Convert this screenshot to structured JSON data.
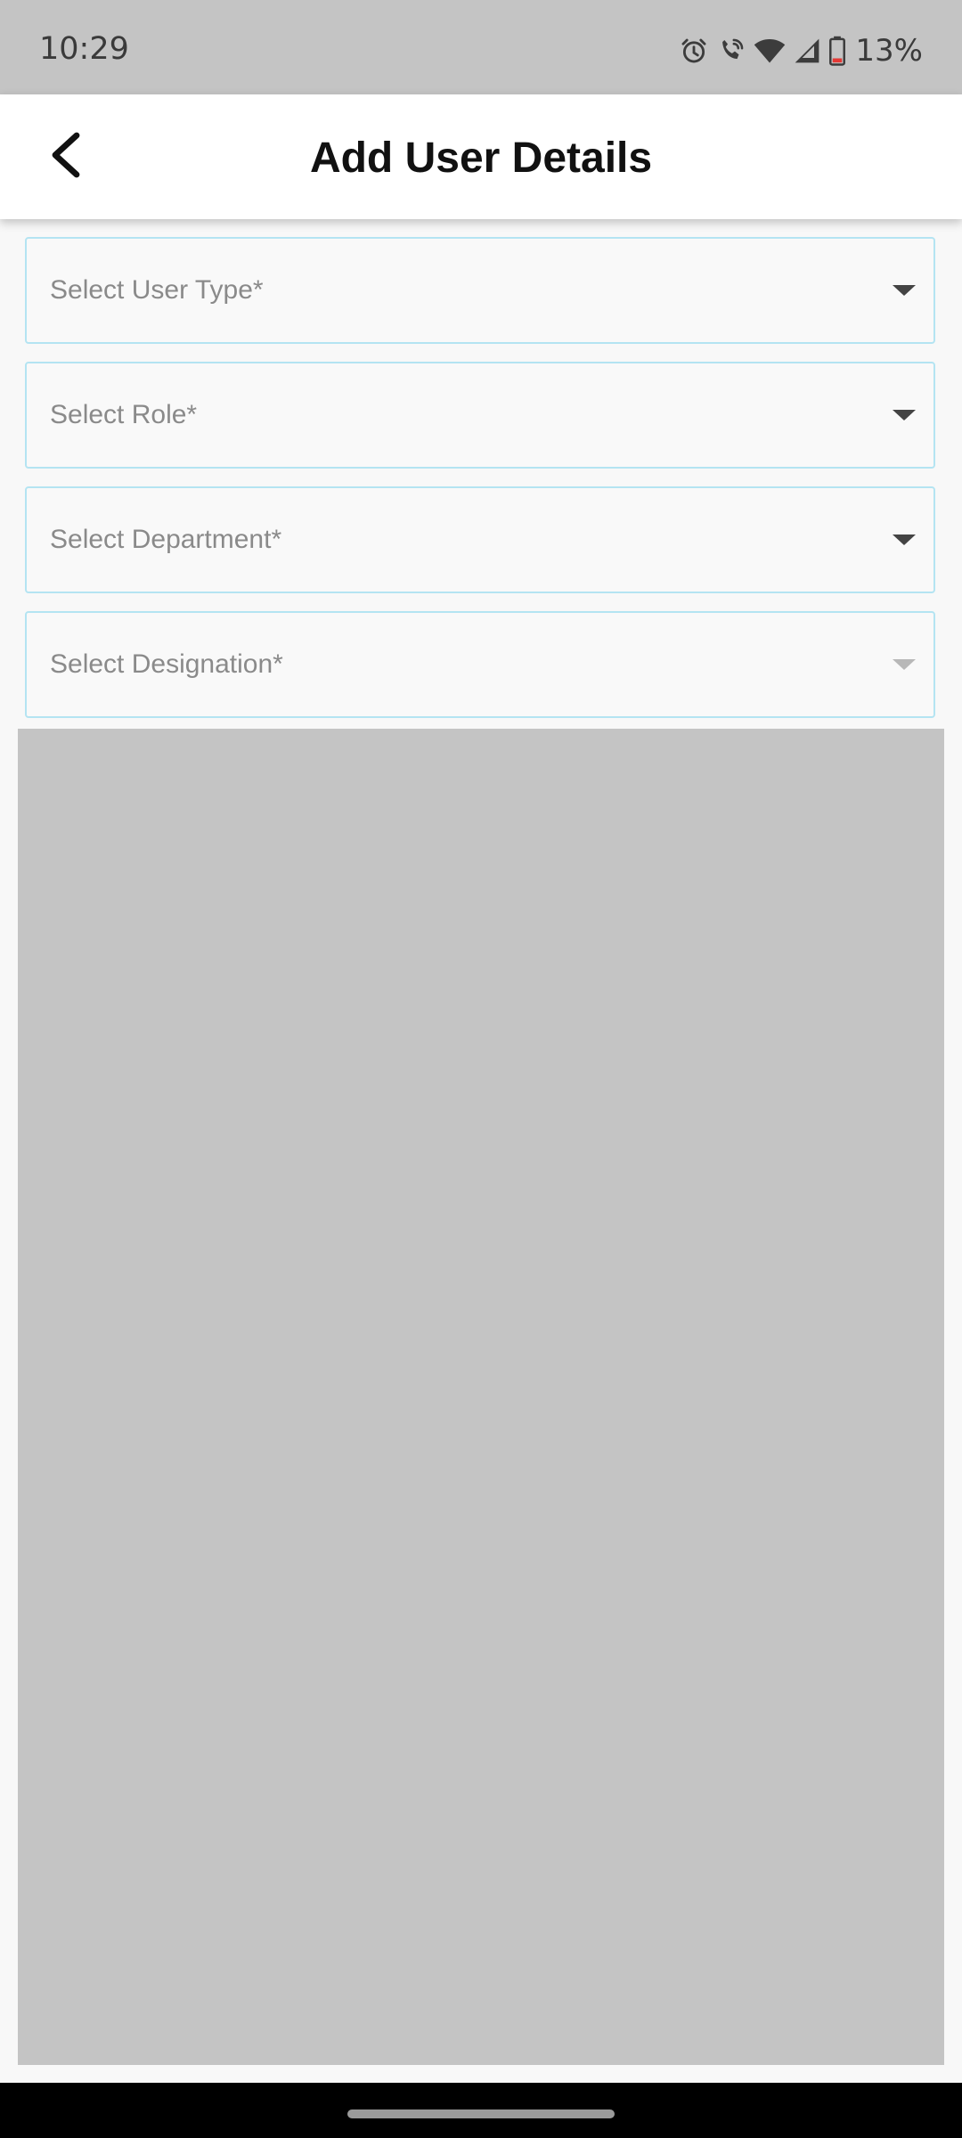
{
  "status_bar": {
    "time": "10:29",
    "battery": "13%",
    "icons": [
      "alarm-icon",
      "wifi-calling-icon",
      "wifi-icon",
      "signal-icon",
      "battery-icon"
    ]
  },
  "header": {
    "title": "Add User Details",
    "back_icon": "chevron-left-icon"
  },
  "form": {
    "fields": [
      {
        "label": "Select User Type*",
        "enabled": true
      },
      {
        "label": "Select Role*",
        "enabled": true
      },
      {
        "label": "Select Department*",
        "enabled": true
      },
      {
        "label": "Select Designation*",
        "enabled": false
      }
    ]
  },
  "colors": {
    "field_border": "#b4e4f2",
    "placeholder_text": "#8a8a8a",
    "overlay": "#c4c4c4",
    "status_bar": "#c4c4c4",
    "battery_low": "#e53935"
  }
}
